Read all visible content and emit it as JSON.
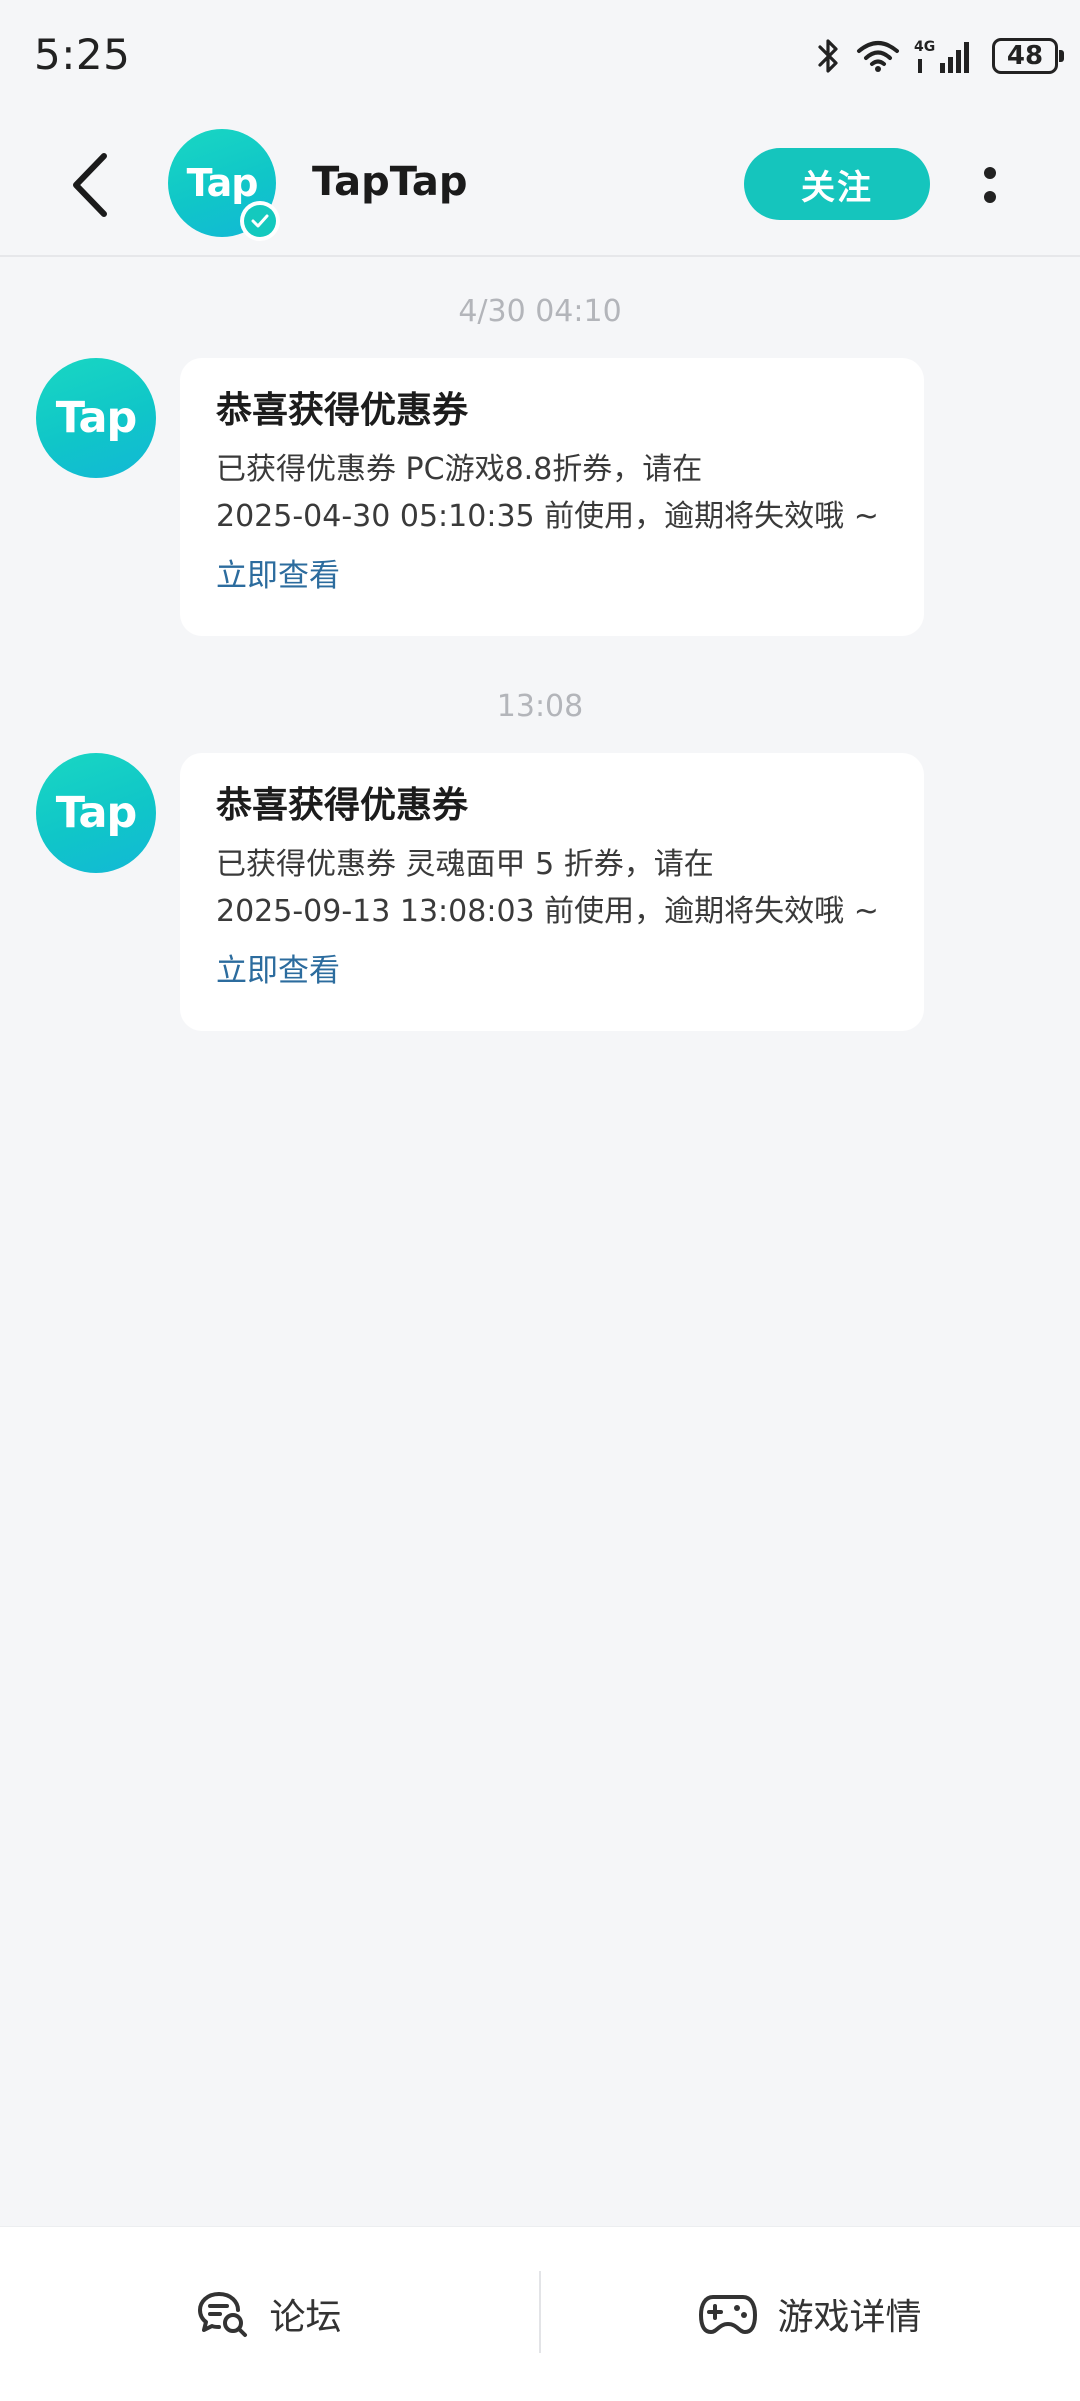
{
  "status_bar": {
    "time": "5:25",
    "battery": "48",
    "icons": [
      "bluetooth-icon",
      "wifi-icon",
      "signal-4g-icon",
      "battery-icon"
    ]
  },
  "header": {
    "title": "TapTap",
    "avatar_text": "Tap",
    "follow_label": "关注",
    "icons": [
      "back-arrow-icon",
      "verified-badge-icon",
      "more-vertical-icon"
    ]
  },
  "messages": [
    {
      "timestamp": "4/30  04:10",
      "avatar_text": "Tap",
      "title": "恭喜获得优惠券",
      "body_line1": "已获得优惠券 PC游戏8.8折券，请在",
      "body_line2": "2025-04-30 05:10:35 前使用，逾期将失效哦 ~",
      "link": "立即查看"
    },
    {
      "timestamp": "13:08",
      "avatar_text": "Tap",
      "title": "恭喜获得优惠券",
      "body_line1": "已获得优惠券 灵魂面甲 5 折券，请在",
      "body_line2": "2025-09-13 13:08:03 前使用，逾期将失效哦 ~",
      "link": "立即查看"
    }
  ],
  "bottom_bar": {
    "forum_label": "论坛",
    "game_details_label": "游戏详情",
    "icons": [
      "forum-chat-icon",
      "gamepad-icon"
    ]
  },
  "colors": {
    "accent": "#15c5bd",
    "link": "#2c6c9e",
    "background": "#f5f6f8"
  }
}
